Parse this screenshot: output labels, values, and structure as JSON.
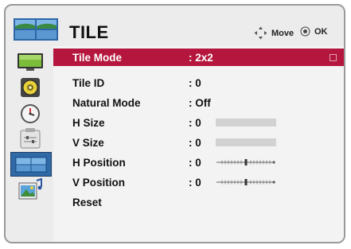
{
  "header": {
    "title": "TILE",
    "move_label": "Move",
    "ok_label": "OK"
  },
  "sidebar": {
    "items": [
      {
        "icon": "picture-icon"
      },
      {
        "icon": "audio-icon"
      },
      {
        "icon": "time-icon"
      },
      {
        "icon": "option-icon"
      },
      {
        "icon": "tile-icon",
        "active": true
      },
      {
        "icon": "media-icon"
      }
    ]
  },
  "menu": {
    "rows": [
      {
        "label": "Tile Mode",
        "value": ": 2x2",
        "selected": true
      },
      {
        "label": "Tile ID",
        "value": ": 0"
      },
      {
        "label": "Natural Mode",
        "value": ": Off"
      },
      {
        "label": "H Size",
        "value": ": 0",
        "control": "bar",
        "level": 0
      },
      {
        "label": "V Size",
        "value": ": 0",
        "control": "bar",
        "level": 0
      },
      {
        "label": "H Position",
        "value": ": 0",
        "control": "scale"
      },
      {
        "label": "V Position",
        "value": ": 0",
        "control": "scale"
      },
      {
        "label": "Reset"
      }
    ]
  },
  "colors": {
    "selection": "#b5163d",
    "active_tab": "#2f6aa6",
    "frame": "#9a9a9a"
  }
}
